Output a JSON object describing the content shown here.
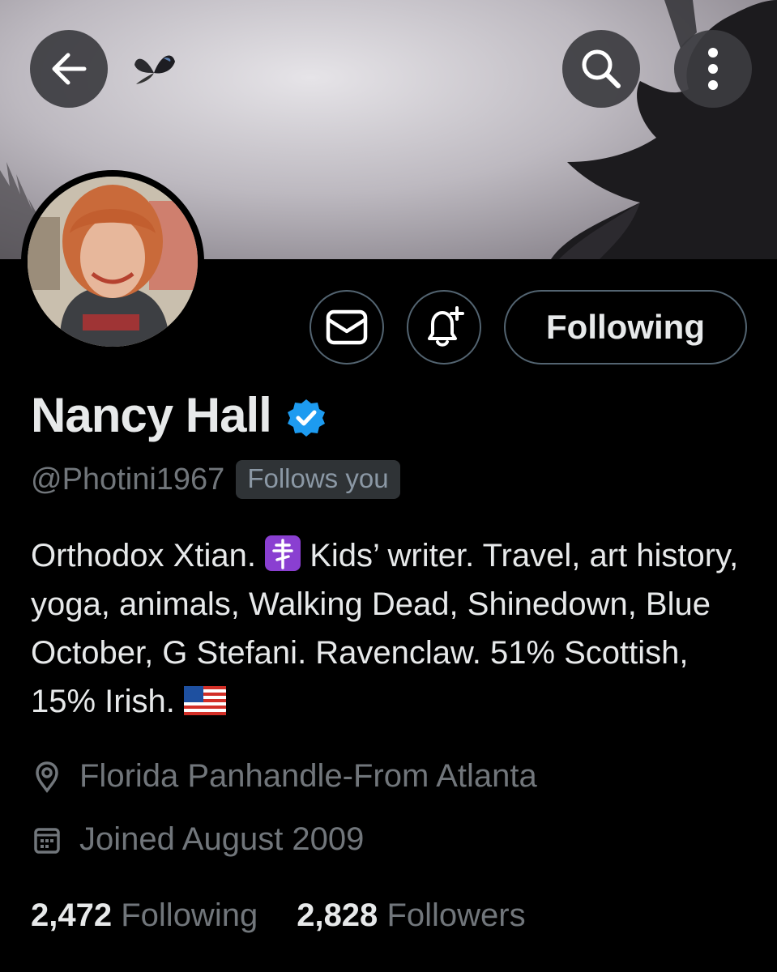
{
  "profile": {
    "name": "Nancy Hall",
    "handle": "@Photini1967",
    "follows_you": "Follows you",
    "bio_part1": "Orthodox Xtian.",
    "bio_part2": "Kids’ writer. Travel, art history, yoga, animals, Walking Dead, Shinedown, Blue October, G Stefani. Ravenclaw. 51% Scottish, 15% Irish.",
    "location": "Florida Panhandle-From Atlanta",
    "joined": "Joined August 2009"
  },
  "actions": {
    "following_label": "Following"
  },
  "stats": {
    "following_count": "2,472",
    "following_label": "Following",
    "followers_count": "2,828",
    "followers_label": "Followers"
  },
  "icons": {
    "back": "arrow-left-icon",
    "search": "search-icon",
    "more": "more-vertical-icon",
    "message": "envelope-icon",
    "notify": "bell-plus-icon",
    "verified": "verified-badge-icon",
    "location": "location-pin-icon",
    "calendar": "calendar-icon"
  },
  "colors": {
    "background": "#000000",
    "text": "#e7e9ea",
    "muted": "#71767b",
    "verified": "#1d9bf0",
    "border": "#536471"
  }
}
